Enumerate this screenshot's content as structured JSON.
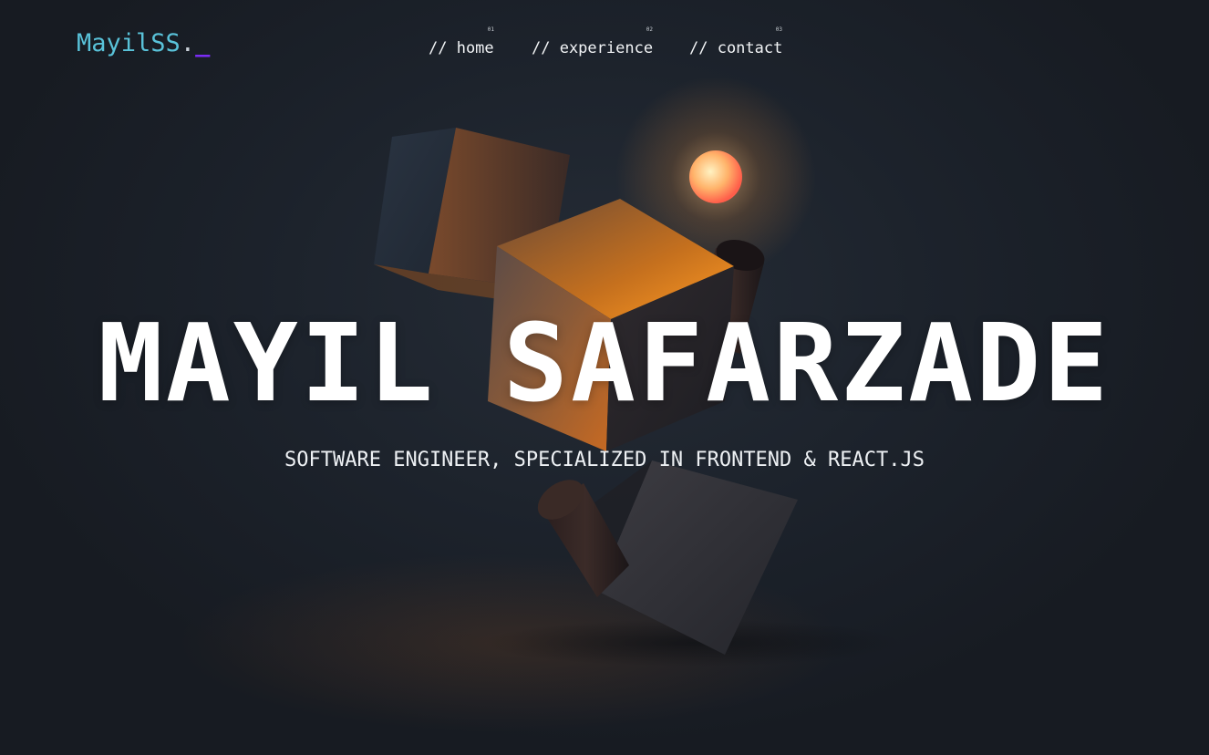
{
  "header": {
    "logo": {
      "text": "MayilSS",
      "dot": ".",
      "cursor": "_"
    },
    "nav": [
      {
        "number": "01",
        "label": "// home"
      },
      {
        "number": "02",
        "label": "// experience"
      },
      {
        "number": "03",
        "label": "// contact"
      }
    ]
  },
  "hero": {
    "name": "MAYIL SAFARZADE",
    "tagline": "SOFTWARE ENGINEER, SPECIALIZED IN FRONTEND & REACT.JS"
  },
  "colors": {
    "logo": "#59c2d9",
    "cursor_accent": "#7b2cf5",
    "text": "#ffffff",
    "background": "#1c222b",
    "glow_orange": "#ff8a1e"
  }
}
